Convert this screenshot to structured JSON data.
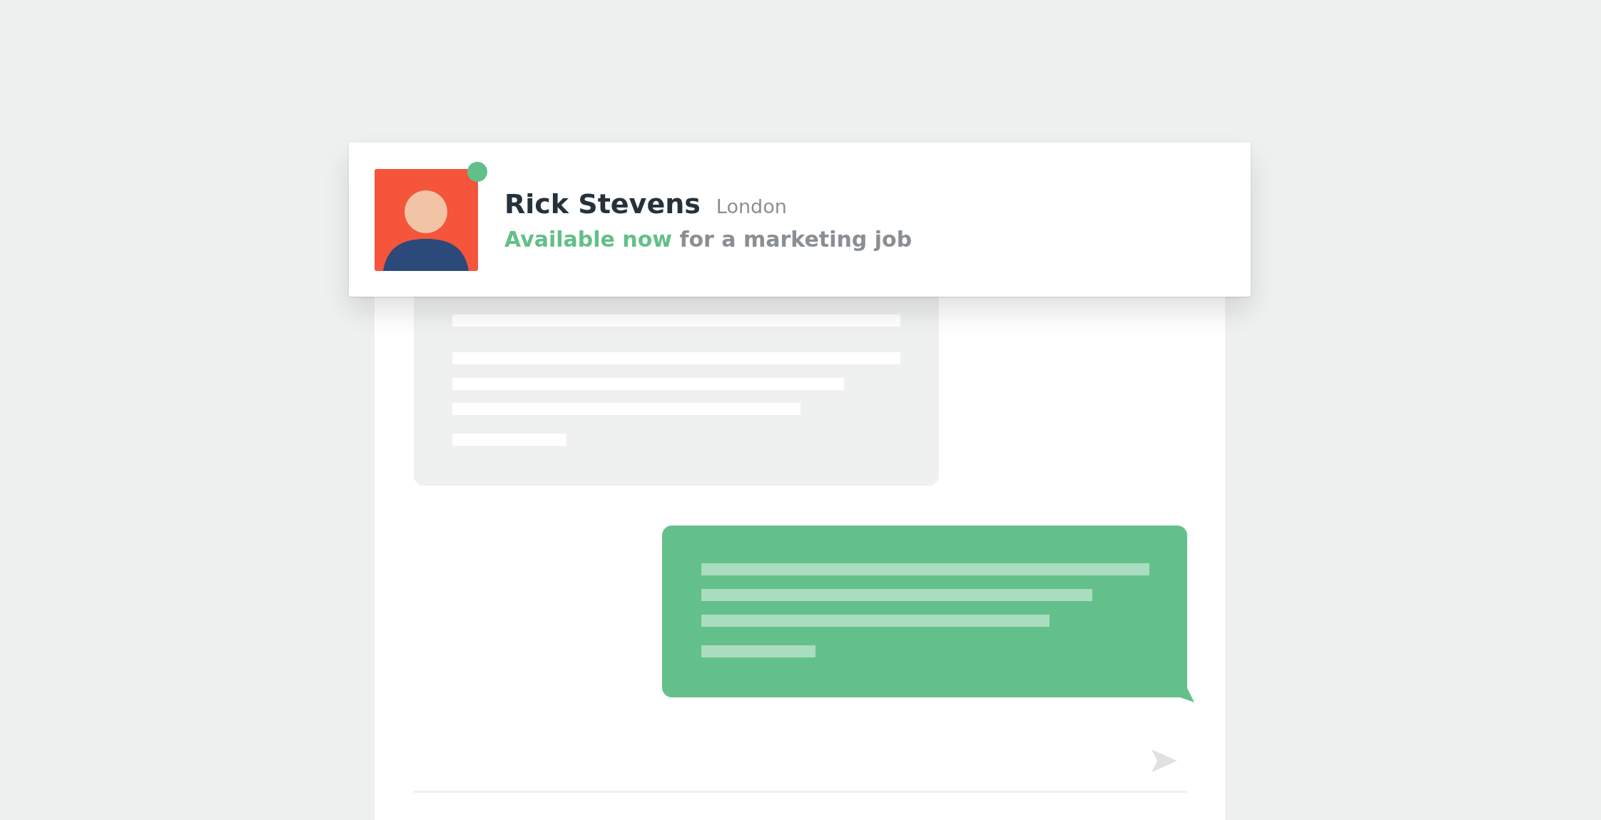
{
  "profile": {
    "name": "Rick Stevens",
    "location": "London",
    "online": true,
    "availability": "Available now",
    "detail": "for a marketing job"
  },
  "messages": [
    {
      "kind": "received"
    },
    {
      "kind": "sent"
    }
  ]
}
